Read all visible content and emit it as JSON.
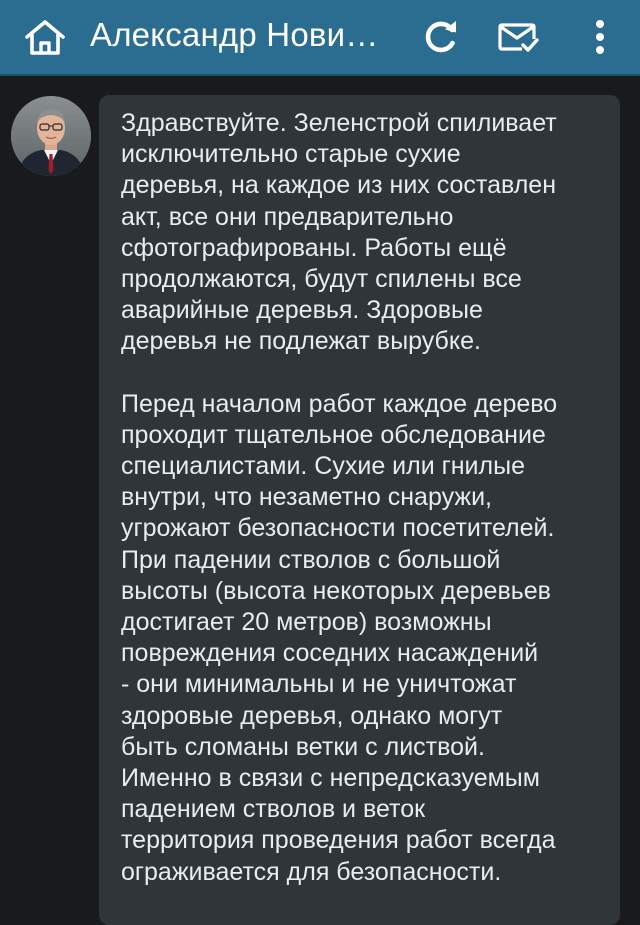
{
  "header": {
    "title": "Александр Нови…",
    "icons": {
      "home": "home-icon",
      "refresh": "refresh-icon",
      "mail": "mail-check-icon",
      "more": "more-vertical-icon"
    },
    "colors": {
      "bar": "#2b6d90",
      "icon": "#ffffff"
    }
  },
  "message": {
    "paragraphs": [
      "Здравствуйте. Зеленстрой спиливает\nисключительно старые сухие\nдеревья, на каждое из них составлен\nакт, все они предварительно\nсфотографированы. Работы ещё\nпродолжаются, будут спилены все\nаварийные деревья. Здоровые\nдеревья не подлежат вырубке.",
      "Перед началом работ каждое дерево\nпроходит тщательное обследование\nспециалистами. Сухие или гнилые\nвнутри, что незаметно снаружи,\nугрожают безопасности посетителей.\nПри падении стволов с большой\nвысоты (высота некоторых деревьев\nдостигает 20 метров) возможны\nповреждения соседних насаждений\n- они минимальны и не уничтожат\nздоровые деревья, однако могут\nбыть сломаны ветки с листвой.\nИменно в связи с непредсказуемым\nпадением стволов и веток\nтерритория проведения работ всегда\nограживается для безопасности."
    ],
    "colors": {
      "bubble": "#30353a",
      "text": "#e9ecee",
      "background": "#181a1c"
    }
  }
}
